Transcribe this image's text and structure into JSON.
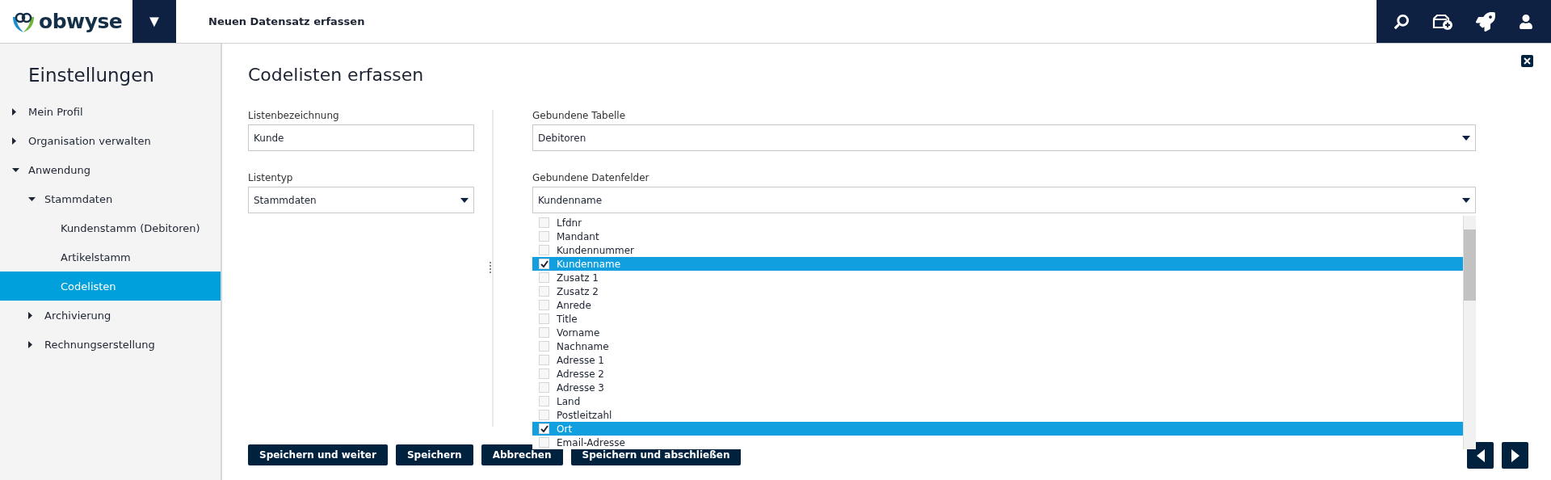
{
  "header": {
    "logo": "obwyse",
    "menu_toggle": "▼",
    "title": "Neuen Datensatz erfassen"
  },
  "sidebar": {
    "title": "Einstellungen",
    "items": [
      {
        "label": "Mein Profil",
        "expanded": false,
        "selected": false
      },
      {
        "label": "Organisation verwalten",
        "expanded": false,
        "selected": false
      },
      {
        "label": "Anwendung",
        "expanded": true,
        "selected": false,
        "children": [
          {
            "label": "Stammdaten",
            "expanded": true,
            "selected": false,
            "children": [
              {
                "label": "Kundenstamm (Debitoren)",
                "selected": false
              },
              {
                "label": "Artikelstamm",
                "selected": false
              },
              {
                "label": "Codelisten",
                "selected": true
              }
            ]
          },
          {
            "label": "Archivierung",
            "expanded": false,
            "selected": false
          },
          {
            "label": "Rechnungserstellung",
            "expanded": false,
            "selected": false
          }
        ]
      }
    ]
  },
  "page": {
    "title": "Codelisten erfassen",
    "left_fields": [
      {
        "kind": "text",
        "label": "Listenbezeichnung",
        "value": "Kunde"
      },
      {
        "kind": "select",
        "label": "Listentyp",
        "value": "Stammdaten"
      }
    ],
    "right_fields": [
      {
        "kind": "select",
        "label": "Gebundene Tabelle",
        "value": "Debitoren"
      },
      {
        "kind": "select",
        "label": "Gebundene Datenfelder",
        "value": "Kundenname"
      }
    ],
    "dropdown_options": [
      {
        "label": "Lfdnr",
        "checked": false
      },
      {
        "label": "Mandant",
        "checked": false
      },
      {
        "label": "Kundennummer",
        "checked": false
      },
      {
        "label": "Kundenname",
        "checked": true
      },
      {
        "label": "Zusatz 1",
        "checked": false
      },
      {
        "label": "Zusatz 2",
        "checked": false
      },
      {
        "label": "Anrede",
        "checked": false
      },
      {
        "label": "Title",
        "checked": false
      },
      {
        "label": "Vorname",
        "checked": false
      },
      {
        "label": "Nachname",
        "checked": false
      },
      {
        "label": "Adresse 1",
        "checked": false
      },
      {
        "label": "Adresse 2",
        "checked": false
      },
      {
        "label": "Adresse 3",
        "checked": false
      },
      {
        "label": "Land",
        "checked": false
      },
      {
        "label": "Postleitzahl",
        "checked": false
      },
      {
        "label": "Ort",
        "checked": true
      },
      {
        "label": "Email-Adresse",
        "checked": false
      }
    ],
    "buttons": [
      "Speichern und weiter",
      "Speichern",
      "Abbrechen",
      "Speichern und abschließen"
    ]
  }
}
